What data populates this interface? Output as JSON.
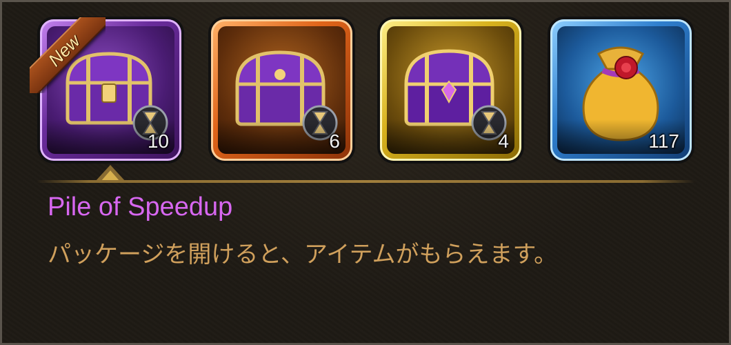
{
  "items": [
    {
      "name": "purple-speedup-chest",
      "count": "10",
      "badge": "New",
      "frame_color": "#a55ad8"
    },
    {
      "name": "orange-speedup-chest",
      "count": "6",
      "frame_color": "#e0651a"
    },
    {
      "name": "gold-speedup-chest",
      "count": "4",
      "frame_color": "#d8b21e"
    },
    {
      "name": "speedup-pouch",
      "count": "117",
      "frame_color": "#2f7fce"
    }
  ],
  "detail": {
    "title": "Pile of Speedup",
    "description": "パッケージを開けると、アイテムがもらえます。",
    "title_color": "#d767f0",
    "description_color": "#d0a05c"
  }
}
